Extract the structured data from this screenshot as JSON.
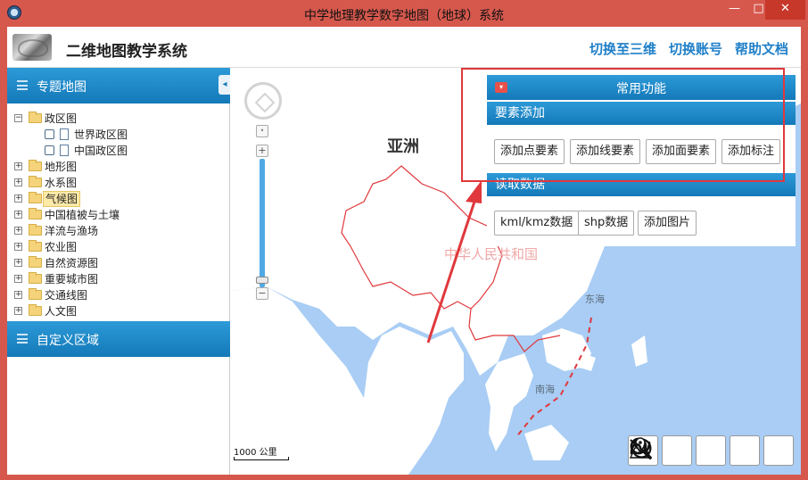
{
  "window": {
    "title": "中学地理教学数字地图（地球）系统",
    "min_label": "—",
    "max_label": "□",
    "close_label": "✕"
  },
  "header": {
    "app_title": "二维地图教学系统",
    "links": [
      "切换至三维",
      "切换账号",
      "帮助文档"
    ]
  },
  "sidebar": {
    "thematic_title": "专题地图",
    "collapse_label": "◂",
    "tree": {
      "root": "政区图",
      "children": [
        "世界政区图",
        "中国政区图"
      ],
      "items": [
        "地形图",
        "水系图",
        "气候图",
        "中国植被与土壤",
        "洋流与渔场",
        "农业图",
        "自然资源图",
        "重要城市图",
        "交通线图",
        "人文图"
      ]
    },
    "custom_title": "自定义区域"
  },
  "map": {
    "labels": {
      "asia": "亚洲",
      "china": "中华人民共和国",
      "east_sea": "东海",
      "south_sea": "南海"
    },
    "scale_label": "1000 公里",
    "zoom_in": "+",
    "zoom_out": "−",
    "tools": [
      "zoom-in-icon",
      "zoom-out-icon",
      "refresh-icon",
      "locate-icon",
      "measure-icon"
    ],
    "colors": {
      "water": "#a9cdf4",
      "land": "#ffffff",
      "border": "#e0383c",
      "accent": "#1479b8"
    }
  },
  "panel": {
    "title": "常用功能",
    "toggle": "▾",
    "feature_section": "要素添加",
    "feature_buttons": [
      "添加点要素",
      "添加线要素",
      "添加面要素",
      "添加标注"
    ],
    "read_section": "读取数据",
    "read_buttons": [
      "kml/kmz数据",
      "shp数据",
      "添加图片"
    ]
  }
}
